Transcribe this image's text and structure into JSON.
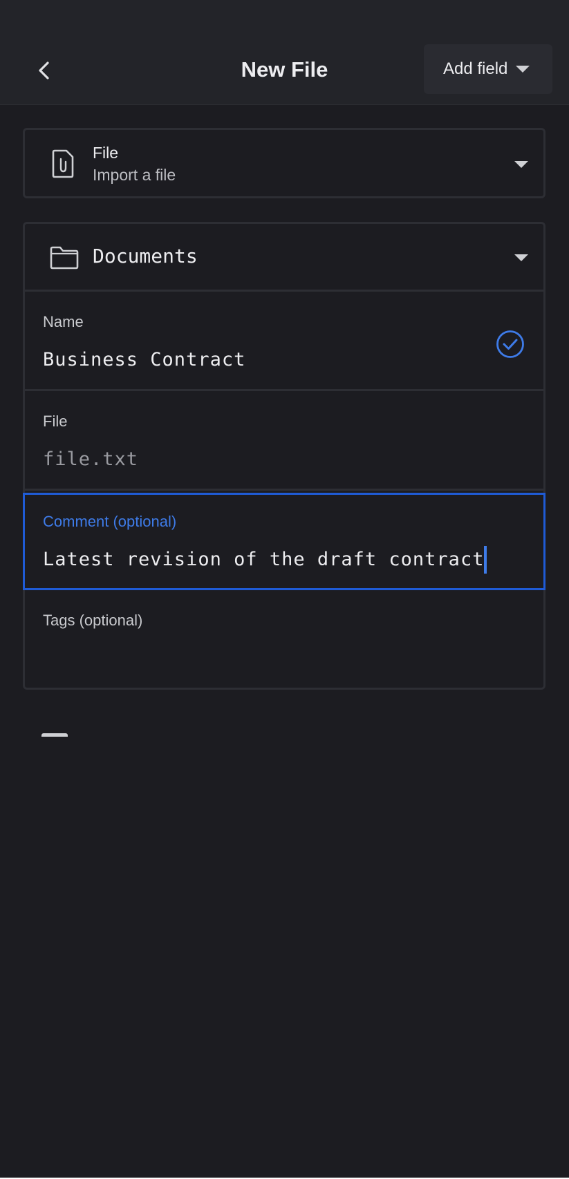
{
  "app_bar": {
    "title": "New File",
    "add_field_label": "Add field",
    "back_icon": "chevron-left-icon"
  },
  "type_selector": {
    "title": "File",
    "subtitle": "Import a file",
    "icon": "file-attachment-icon"
  },
  "folder": {
    "label": "Documents",
    "icon": "folder-icon"
  },
  "fields": {
    "name": {
      "label": "Name",
      "value": "Business Contract"
    },
    "file": {
      "label": "File",
      "placeholder": "file.txt"
    },
    "comment": {
      "label": "Comment (optional)",
      "value": "Latest revision of the draft contract"
    },
    "tags": {
      "label": "Tags (optional)",
      "value": ""
    }
  },
  "colors": {
    "background": "#1c1c21",
    "accent": "#1f5bd6",
    "accent_text": "#3e7be8"
  }
}
